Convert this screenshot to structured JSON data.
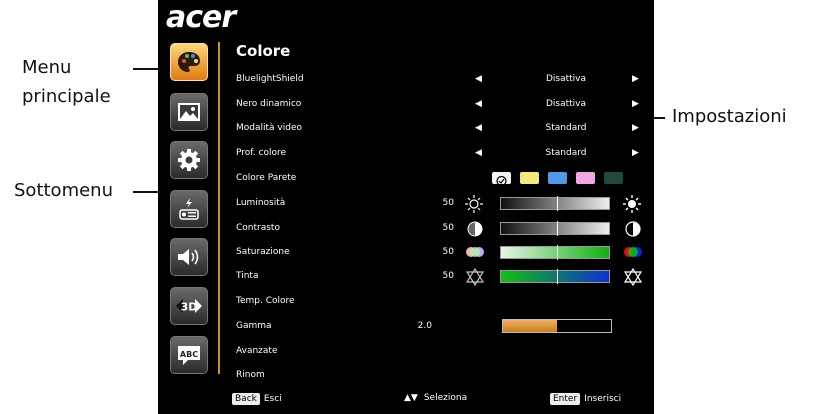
{
  "callouts": {
    "menu_line1": "Menu",
    "menu_line2": "principale",
    "submenu": "Sottomenu",
    "settings": "Impostazioni"
  },
  "osd": {
    "brand": "acer",
    "section_title": "Colore",
    "main_menu_icons": [
      "palette-icon",
      "picture-icon",
      "gear-icon",
      "timer-icon",
      "speaker-icon",
      "3d-icon",
      "language-icon"
    ],
    "rows": {
      "bluelight": {
        "label": "BluelightShield",
        "value": "Disattiva"
      },
      "dynamic_black": {
        "label": "Nero dinamico",
        "value": "Disattiva"
      },
      "video_mode": {
        "label": "Modalità video",
        "value": "Standard"
      },
      "color_profile": {
        "label": "Prof. colore",
        "value": "Standard"
      },
      "wall_color": {
        "label": "Colore Parete",
        "swatches": [
          "#f4f4f4",
          "#f3ea7a",
          "#4f9bea",
          "#f2a6e8",
          "#214a3a"
        ]
      },
      "brightness": {
        "label": "Luminosità",
        "value": "50",
        "level": 0.5
      },
      "contrast": {
        "label": "Contrasto",
        "value": "50",
        "level": 0.5
      },
      "saturation": {
        "label": "Saturazione",
        "value": "50",
        "level": 0.5
      },
      "tint": {
        "label": "Tinta",
        "value": "50",
        "level": 0.5
      },
      "color_temp": {
        "label": "Temp. Colore"
      },
      "gamma": {
        "label": "Gamma",
        "value": "2.0",
        "level": 0.5
      },
      "advanced": {
        "label": "Avanzate"
      },
      "reset": {
        "label": "Rinom"
      }
    },
    "footer": {
      "back_key": "Back",
      "back_label": "Esci",
      "select_label": "Seleziona",
      "enter_key": "Enter",
      "enter_label": "Inserisci"
    },
    "colors": {
      "accent": "#e08a18",
      "divider": "#c8901e"
    }
  }
}
